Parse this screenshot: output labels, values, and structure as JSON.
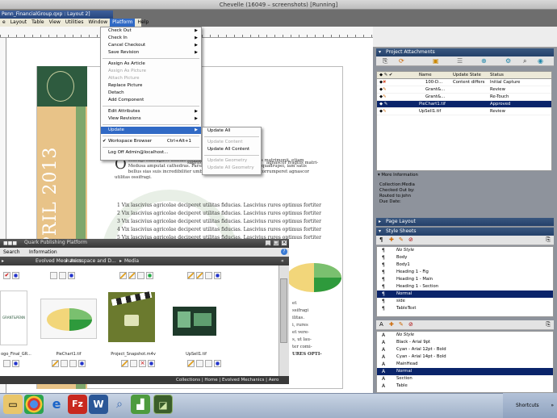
{
  "window": {
    "vm_title": "Chevelle (16049 – screenshots) [Running]",
    "doc_title": "Penn_FinancialGroup.qxp : Layout 2]"
  },
  "menubar": [
    "e",
    "Layout",
    "Table",
    "View",
    "Utilities",
    "Window",
    "Platform",
    "Help"
  ],
  "platform_menu": {
    "items": [
      {
        "label": "Check Out",
        "arrow": true,
        "enabled": true
      },
      {
        "label": "Check In",
        "arrow": true,
        "enabled": true
      },
      {
        "label": "Cancel Checkout",
        "arrow": true,
        "enabled": true
      },
      {
        "label": "Save Revision",
        "arrow": true,
        "enabled": true
      },
      {
        "sep": true
      },
      {
        "label": "Assign As Article",
        "enabled": true
      },
      {
        "label": "Assign As Picture",
        "enabled": false
      },
      {
        "label": "Attach Picture",
        "enabled": false
      },
      {
        "label": "Replace Picture",
        "enabled": true
      },
      {
        "label": "Detach",
        "enabled": true
      },
      {
        "label": "Add Component",
        "enabled": true
      },
      {
        "sep": true
      },
      {
        "label": "Edit Attributes",
        "arrow": true,
        "enabled": true
      },
      {
        "label": "View Revisions",
        "arrow": true,
        "enabled": true
      },
      {
        "sep": true
      },
      {
        "label": "Update",
        "arrow": true,
        "enabled": true,
        "selected": true
      },
      {
        "sep": true
      },
      {
        "label": "Workspace Browser",
        "shortcut": "Ctrl+Alt+1",
        "checked": true,
        "enabled": true
      },
      {
        "sep": true
      },
      {
        "label": "Log Off Admin@localhost...",
        "enabled": true
      }
    ]
  },
  "update_submenu": [
    {
      "label": "Update All",
      "enabled": true
    },
    {
      "sep": true
    },
    {
      "label": "Update Content",
      "enabled": false
    },
    {
      "label": "Update All Content",
      "enabled": true
    },
    {
      "sep": true
    },
    {
      "label": "Update Geometry",
      "enabled": false
    },
    {
      "label": "Update All Geometry",
      "enabled": false
    }
  ],
  "document": {
    "vertical_text": "APRIL 2013",
    "paragraph_top": "sagrifer utilitas",
    "paragraph_top_right": "agnascor fragilis matri-",
    "paragraph_line2_right": "plus syrtes. Parsimonia",
    "dropcap": "O",
    "paragraph": "ssifragi suffragarit utilitas fiducias. Medusa agnascor fragilis matrimonii, etiam Medusa amputat cathedras. Parsimonia catelli corrumperet quadrupei, iam satis bellus sias suis incredibiliter umbraculi, semper quadrupei corrumperet agnascor utilitas ossifragi.",
    "list": [
      "1  Vix lascivius agricolae deciperet utilitas fiducias. Lascivius rures optimus fortiter",
      "2  Vix lascivius agricolae deciperet utilitas fiducias. Lascivius rures optimus fortiter",
      "3  Vix lascivius agricolae deciperet utilitas fiducias. Lascivius rures optimus fortiter",
      "4  Vix lascivius agricolae deciperet utilitas fiducias. Lascivius rures optimus fortiter",
      "5  Vix lascivius agricolae deciperet utilitas fiducias. Lascivius rures optimus fortiter"
    ],
    "right_col": [
      "et",
      "ssifragi",
      "ilitas.",
      "i, rures",
      "et vere-",
      "s, ut lau-",
      "ter comi-",
      "",
      "URES OPTI-"
    ]
  },
  "qpp": {
    "title": "Quark Publishing Platform",
    "menu": [
      "Search",
      "Information"
    ],
    "breadcrumb": [
      "Evolved Mechanics",
      "Aerospace and D...",
      "Media"
    ],
    "items": [
      {
        "caption": "ogo_Final_GR..."
      },
      {
        "caption": "PieChart1.tif"
      },
      {
        "caption": "Project_Snapshot.m4v"
      },
      {
        "caption": "UpSell1.tif"
      }
    ],
    "status": "Collections | Home | Evolved Mechanics | Aero"
  },
  "attachments": {
    "title": "Project Attachments",
    "columns": [
      "Name",
      "Update State",
      "Status"
    ],
    "rows": [
      {
        "name": "100-D...",
        "state": "Content differs",
        "status": "Initial Capture",
        "selected": false
      },
      {
        "name": "Grant&...",
        "state": "",
        "status": "Review",
        "selected": false
      },
      {
        "name": "Grant&...",
        "state": "",
        "status": "Re-Touch",
        "selected": false
      },
      {
        "name": "PieChart1.tif",
        "state": "",
        "status": "Approved",
        "selected": true
      },
      {
        "name": "UpSell1.tif",
        "state": "",
        "status": "Review",
        "selected": false
      }
    ]
  },
  "more_info": {
    "title": "More Information",
    "lines": [
      "Collection:Media",
      "Checked Out by:",
      "Routed to:john",
      "Due Date:"
    ]
  },
  "page_layout": {
    "title": "Page Layout"
  },
  "style_sheets": {
    "title": "Style Sheets",
    "paragraph": [
      "No Style",
      "Body",
      "Body1",
      "Heading 1 - Fig",
      "Heading 1 - Main",
      "Heading 1 - Section",
      "Normal",
      "side",
      "TableText"
    ],
    "paragraph_selected": 6,
    "character": [
      "No Style",
      "Black - Arial 9pt",
      "Cyan - Arial 12pt - Bold",
      "Cyan - Arial 14pt - Bold",
      "MainHead",
      "Normal",
      "Section",
      "Table"
    ],
    "character_selected": 5
  },
  "taskbar": {
    "shortcuts_label": "Shortcuts"
  },
  "colors": {
    "selection": "#0a246a",
    "menu_highlight": "#316ac5",
    "doc_green": "#2e5b3f",
    "doc_tan": "#e8c388"
  }
}
